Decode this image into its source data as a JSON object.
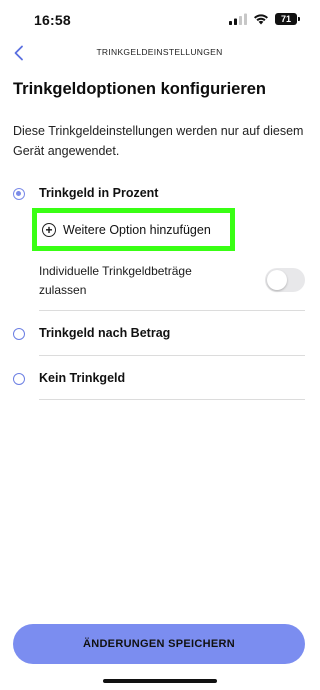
{
  "status_bar": {
    "time": "16:58",
    "battery": "71"
  },
  "nav": {
    "title": "TRINKGELDEINSTELLUNGEN"
  },
  "page": {
    "title": "Trinkgeldoptionen konfigurieren",
    "description": "Diese Trinkgeldeinstellungen werden nur auf diesem Gerät angewendet."
  },
  "options": {
    "percent": {
      "label": "Trinkgeld in Prozent",
      "selected": true
    },
    "add_option": {
      "icon": "+",
      "label": "Weitere Option hinzufügen"
    },
    "custom_amounts": {
      "label": "Individuelle Trinkgeldbeträge zulassen",
      "enabled": false
    },
    "by_amount": {
      "label": "Trinkgeld nach Betrag",
      "selected": false
    },
    "none": {
      "label": "Kein Trinkgeld",
      "selected": false
    }
  },
  "footer": {
    "save_label": "ÄNDERUNGEN SPEICHERN"
  },
  "colors": {
    "accent": "#7b8df0",
    "highlight": "#39ff14",
    "radio": "#6c7fe3"
  }
}
